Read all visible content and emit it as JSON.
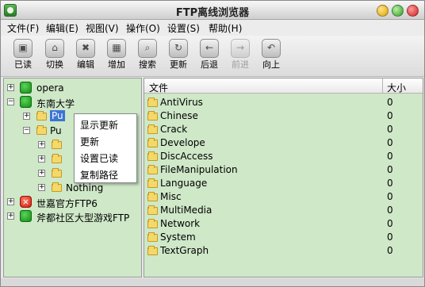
{
  "window": {
    "title": "FTP离线浏览器"
  },
  "menubar": [
    {
      "label": "文件(F)"
    },
    {
      "label": "编辑(E)"
    },
    {
      "label": "视图(V)"
    },
    {
      "label": "操作(O)"
    },
    {
      "label": "设置(S)"
    },
    {
      "label": "帮助(H)"
    }
  ],
  "toolbar": [
    {
      "label": "已读",
      "icon": "mark-read-icon"
    },
    {
      "label": "切换",
      "icon": "switch-icon"
    },
    {
      "label": "编辑",
      "icon": "edit-icon"
    },
    {
      "label": "增加",
      "icon": "add-icon"
    },
    {
      "label": "搜索",
      "icon": "search-icon"
    },
    {
      "label": "更新",
      "icon": "refresh-icon"
    },
    {
      "label": "后退",
      "icon": "back-icon"
    },
    {
      "label": "前进",
      "icon": "forward-icon"
    },
    {
      "label": "向上",
      "icon": "up-icon"
    }
  ],
  "tree": {
    "nodes": [
      {
        "label": "opera"
      },
      {
        "label": "东南大学"
      },
      {
        "label": "Pu"
      },
      {
        "label": "Pu"
      },
      {
        "label": "Nothing"
      },
      {
        "label": "世嘉官方FTP6"
      },
      {
        "label": "斧都社区大型游戏FTP"
      }
    ]
  },
  "context_menu": [
    {
      "label": "显示更新"
    },
    {
      "label": "更新"
    },
    {
      "label": "设置已读"
    },
    {
      "label": "复制路径"
    }
  ],
  "file_list": {
    "headers": {
      "name": "文件",
      "size": "大小"
    },
    "rows": [
      {
        "name": "AntiVirus",
        "size": "0"
      },
      {
        "name": "Chinese",
        "size": "0"
      },
      {
        "name": "Crack",
        "size": "0"
      },
      {
        "name": "Develope",
        "size": "0"
      },
      {
        "name": "DiscAccess",
        "size": "0"
      },
      {
        "name": "FileManipulation",
        "size": "0"
      },
      {
        "name": "Language",
        "size": "0"
      },
      {
        "name": "Misc",
        "size": "0"
      },
      {
        "name": "MultiMedia",
        "size": "0"
      },
      {
        "name": "Network",
        "size": "0"
      },
      {
        "name": "System",
        "size": "0"
      },
      {
        "name": "TextGraph",
        "size": "0"
      }
    ]
  }
}
